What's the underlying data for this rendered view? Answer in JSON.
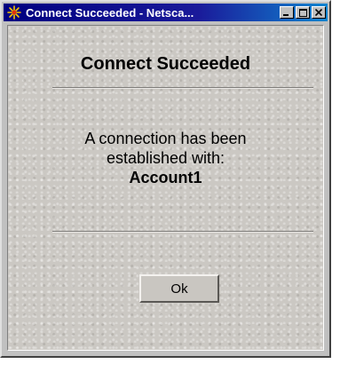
{
  "window": {
    "title": "Connect Succeeded - Netsca...",
    "app_icon": "netscape-burst-icon",
    "controls": [
      "minimize-icon",
      "maximize-icon",
      "close-icon"
    ]
  },
  "dialog": {
    "heading": "Connect Succeeded",
    "message_line1": "A connection has been",
    "message_line2": "established with:",
    "account": "Account1",
    "ok_label": "Ok"
  },
  "colors": {
    "titlebar": "#000080",
    "face": "#c0c0c0",
    "content_bg": "#cbc8c3"
  }
}
